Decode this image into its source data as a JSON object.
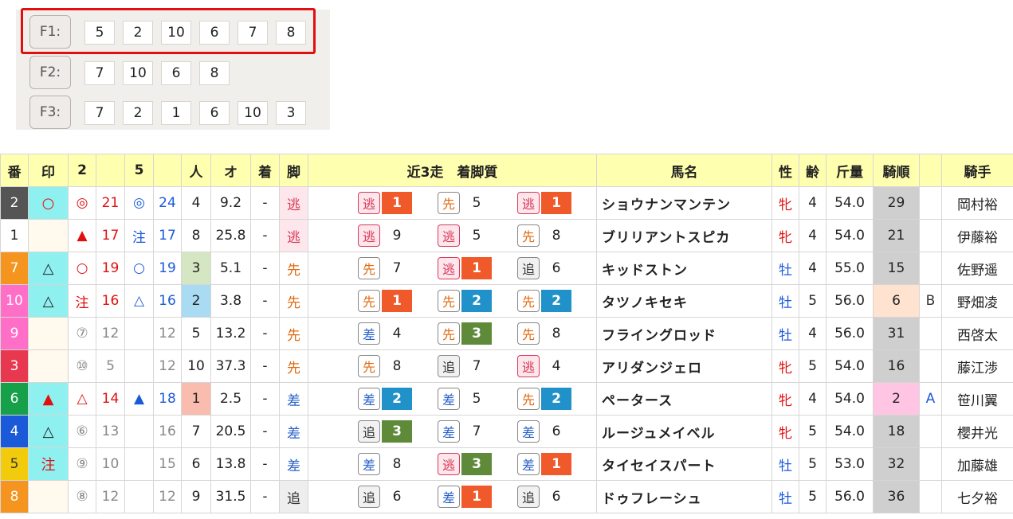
{
  "formations": [
    {
      "label": "F1:",
      "numbers": [
        "5",
        "2",
        "10",
        "6",
        "7",
        "8"
      ]
    },
    {
      "label": "F2:",
      "numbers": [
        "7",
        "10",
        "6",
        "8"
      ]
    },
    {
      "label": "F3:",
      "numbers": [
        "7",
        "2",
        "1",
        "6",
        "10",
        "3"
      ]
    }
  ],
  "table": {
    "headers": {
      "ban": "番",
      "shirushi": "印",
      "col2": "2",
      "col2b": "",
      "col5": "5",
      "col5b": "",
      "ninki": "人",
      "odds": "オ",
      "chaku": "着",
      "ashi": "脚",
      "recent": "近3走　着脚質",
      "name": "馬名",
      "sex": "性",
      "age": "齢",
      "weight": "斤量",
      "order": "騎順",
      "grade": "",
      "jockey": "騎手"
    },
    "rows": [
      {
        "ban": "2",
        "frame_color": "#555555",
        "mark": "○",
        "mark_bg": "#8ff0f0",
        "mark_color": "red",
        "m2": "◎",
        "m2_color": "red",
        "v2": "21",
        "v2_color": "red",
        "m5": "◎",
        "m5_color": "blue",
        "v5": "24",
        "v5_color": "blue",
        "ninki": "4",
        "ninki_bg": "",
        "odds": "9.2",
        "chaku": "-",
        "ashi": "逃",
        "ashi_type": "nige",
        "recent": [
          {
            "style": "逃",
            "type": "nige",
            "rank": "1",
            "rank_class": "r1"
          },
          {
            "style": "先",
            "type": "sen",
            "rank": "5",
            "rank_class": ""
          },
          {
            "style": "逃",
            "type": "nige",
            "rank": "1",
            "rank_class": "r1"
          }
        ],
        "name": "ショウナンマンテン",
        "sex": "牝",
        "sex_type": "f",
        "age": "4",
        "weight": "54.0",
        "order": "29",
        "order_bg": "#cfcfcf",
        "grade": "",
        "grade_type": "",
        "jockey": "岡村裕"
      },
      {
        "ban": "1",
        "frame_color": "#ffffff",
        "mark": "",
        "mark_bg": "#fff9ee",
        "mark_color": "dark",
        "m2": "▲",
        "m2_color": "red",
        "v2": "17",
        "v2_color": "red",
        "m5": "注",
        "m5_color": "blue",
        "v5": "17",
        "v5_color": "blue",
        "ninki": "8",
        "ninki_bg": "",
        "odds": "25.8",
        "chaku": "-",
        "ashi": "逃",
        "ashi_type": "nige",
        "recent": [
          {
            "style": "逃",
            "type": "nige",
            "rank": "9",
            "rank_class": ""
          },
          {
            "style": "逃",
            "type": "nige",
            "rank": "5",
            "rank_class": ""
          },
          {
            "style": "先",
            "type": "sen",
            "rank": "8",
            "rank_class": ""
          }
        ],
        "name": "ブリリアントスピカ",
        "sex": "牝",
        "sex_type": "f",
        "age": "4",
        "weight": "54.0",
        "order": "21",
        "order_bg": "#cfcfcf",
        "grade": "",
        "grade_type": "",
        "jockey": "伊藤裕"
      },
      {
        "ban": "7",
        "frame_color": "#f5951f",
        "mark": "△",
        "mark_bg": "#8ff0f0",
        "mark_color": "dark",
        "m2": "○",
        "m2_color": "red",
        "v2": "19",
        "v2_color": "red",
        "m5": "○",
        "m5_color": "blue",
        "v5": "19",
        "v5_color": "blue",
        "ninki": "3",
        "ninki_bg": "#d5e6c3",
        "odds": "5.1",
        "chaku": "-",
        "ashi": "先",
        "ashi_type": "sen",
        "recent": [
          {
            "style": "先",
            "type": "sen",
            "rank": "7",
            "rank_class": ""
          },
          {
            "style": "逃",
            "type": "nige",
            "rank": "1",
            "rank_class": "r1"
          },
          {
            "style": "追",
            "type": "oi",
            "rank": "6",
            "rank_class": ""
          }
        ],
        "name": "キッドストン",
        "sex": "牡",
        "sex_type": "m",
        "age": "4",
        "weight": "55.0",
        "order": "15",
        "order_bg": "#cfcfcf",
        "grade": "",
        "grade_type": "",
        "jockey": "佐野遥"
      },
      {
        "ban": "10",
        "frame_color": "#ff6fc8",
        "mark": "△",
        "mark_bg": "#8ff0f0",
        "mark_color": "dark",
        "m2": "注",
        "m2_color": "red",
        "v2": "16",
        "v2_color": "red",
        "m5": "△",
        "m5_color": "blue",
        "v5": "16",
        "v5_color": "blue",
        "ninki": "2",
        "ninki_bg": "#a9dbf3",
        "odds": "3.8",
        "chaku": "-",
        "ashi": "先",
        "ashi_type": "sen",
        "recent": [
          {
            "style": "先",
            "type": "sen",
            "rank": "1",
            "rank_class": "r1"
          },
          {
            "style": "先",
            "type": "sen",
            "rank": "2",
            "rank_class": "r2"
          },
          {
            "style": "先",
            "type": "sen",
            "rank": "2",
            "rank_class": "r2"
          }
        ],
        "name": "タツノキセキ",
        "sex": "牡",
        "sex_type": "m",
        "age": "5",
        "weight": "56.0",
        "order": "6",
        "order_bg": "#ffe2cf",
        "grade": "B",
        "grade_type": "B",
        "jockey": "野畑凌"
      },
      {
        "ban": "9",
        "frame_color": "#ff6fc8",
        "mark": "",
        "mark_bg": "#fff9ee",
        "mark_color": "dark",
        "m2": "⑦",
        "m2_color": "gray",
        "v2": "12",
        "v2_color": "gray",
        "m5": "",
        "m5_color": "gray",
        "v5": "12",
        "v5_color": "gray",
        "ninki": "5",
        "ninki_bg": "",
        "odds": "13.2",
        "chaku": "-",
        "ashi": "先",
        "ashi_type": "sen",
        "recent": [
          {
            "style": "差",
            "type": "sashi",
            "rank": "4",
            "rank_class": ""
          },
          {
            "style": "先",
            "type": "sen",
            "rank": "3",
            "rank_class": "r3"
          },
          {
            "style": "先",
            "type": "sen",
            "rank": "8",
            "rank_class": ""
          }
        ],
        "name": "フライングロッド",
        "sex": "牡",
        "sex_type": "m",
        "age": "4",
        "weight": "56.0",
        "order": "31",
        "order_bg": "#cfcfcf",
        "grade": "",
        "grade_type": "",
        "jockey": "西啓太"
      },
      {
        "ban": "3",
        "frame_color": "#e8384f",
        "mark": "",
        "mark_bg": "#fff9ee",
        "mark_color": "dark",
        "m2": "⑩",
        "m2_color": "gray",
        "v2": "5",
        "v2_color": "gray",
        "m5": "",
        "m5_color": "gray",
        "v5": "12",
        "v5_color": "gray",
        "ninki": "10",
        "ninki_bg": "",
        "odds": "37.3",
        "chaku": "-",
        "ashi": "先",
        "ashi_type": "sen",
        "recent": [
          {
            "style": "先",
            "type": "sen",
            "rank": "8",
            "rank_class": ""
          },
          {
            "style": "追",
            "type": "oi",
            "rank": "7",
            "rank_class": ""
          },
          {
            "style": "逃",
            "type": "nige",
            "rank": "4",
            "rank_class": ""
          }
        ],
        "name": "アリダンジェロ",
        "sex": "牝",
        "sex_type": "f",
        "age": "5",
        "weight": "54.0",
        "order": "16",
        "order_bg": "#cfcfcf",
        "grade": "",
        "grade_type": "",
        "jockey": "藤江渉"
      },
      {
        "ban": "6",
        "frame_color": "#16a04a",
        "mark": "▲",
        "mark_bg": "#8ff0f0",
        "mark_color": "red",
        "m2": "△",
        "m2_color": "red",
        "v2": "14",
        "v2_color": "red",
        "m5": "▲",
        "m5_color": "blue",
        "v5": "18",
        "v5_color": "blue",
        "ninki": "1",
        "ninki_bg": "#f9bcae",
        "odds": "2.5",
        "chaku": "-",
        "ashi": "差",
        "ashi_type": "sashi",
        "recent": [
          {
            "style": "差",
            "type": "sashi",
            "rank": "2",
            "rank_class": "r2"
          },
          {
            "style": "差",
            "type": "sashi",
            "rank": "5",
            "rank_class": ""
          },
          {
            "style": "先",
            "type": "sen",
            "rank": "2",
            "rank_class": "r2"
          }
        ],
        "name": "ペータース",
        "sex": "牝",
        "sex_type": "f",
        "age": "4",
        "weight": "54.0",
        "order": "2",
        "order_bg": "#ffc5e3",
        "grade": "A",
        "grade_type": "A",
        "jockey": "笹川翼"
      },
      {
        "ban": "4",
        "frame_color": "#1a5ad8",
        "mark": "△",
        "mark_bg": "#8ff0f0",
        "mark_color": "dark",
        "m2": "⑥",
        "m2_color": "gray",
        "v2": "13",
        "v2_color": "gray",
        "m5": "",
        "m5_color": "gray",
        "v5": "16",
        "v5_color": "gray",
        "ninki": "7",
        "ninki_bg": "",
        "odds": "20.5",
        "chaku": "-",
        "ashi": "差",
        "ashi_type": "sashi",
        "recent": [
          {
            "style": "追",
            "type": "oi",
            "rank": "3",
            "rank_class": "r3"
          },
          {
            "style": "差",
            "type": "sashi",
            "rank": "7",
            "rank_class": ""
          },
          {
            "style": "差",
            "type": "sashi",
            "rank": "6",
            "rank_class": ""
          }
        ],
        "name": "ルージュメイベル",
        "sex": "牝",
        "sex_type": "f",
        "age": "5",
        "weight": "54.0",
        "order": "18",
        "order_bg": "#cfcfcf",
        "grade": "",
        "grade_type": "",
        "jockey": "櫻井光"
      },
      {
        "ban": "5",
        "frame_color": "#f2cc0c",
        "mark": "注",
        "mark_bg": "#8ff0f0",
        "mark_color": "red",
        "m2": "⑨",
        "m2_color": "gray",
        "v2": "10",
        "v2_color": "gray",
        "m5": "",
        "m5_color": "gray",
        "v5": "15",
        "v5_color": "gray",
        "ninki": "6",
        "ninki_bg": "",
        "odds": "13.8",
        "chaku": "-",
        "ashi": "差",
        "ashi_type": "sashi",
        "recent": [
          {
            "style": "差",
            "type": "sashi",
            "rank": "8",
            "rank_class": ""
          },
          {
            "style": "逃",
            "type": "nige",
            "rank": "3",
            "rank_class": "r3"
          },
          {
            "style": "差",
            "type": "sashi",
            "rank": "1",
            "rank_class": "r1"
          }
        ],
        "name": "タイセイスパート",
        "sex": "牡",
        "sex_type": "m",
        "age": "5",
        "weight": "53.0",
        "order": "32",
        "order_bg": "#cfcfcf",
        "grade": "",
        "grade_type": "",
        "jockey": "加藤雄"
      },
      {
        "ban": "8",
        "frame_color": "#f5951f",
        "mark": "",
        "mark_bg": "#fff9ee",
        "mark_color": "dark",
        "m2": "⑧",
        "m2_color": "gray",
        "v2": "12",
        "v2_color": "gray",
        "m5": "",
        "m5_color": "gray",
        "v5": "12",
        "v5_color": "gray",
        "ninki": "9",
        "ninki_bg": "",
        "odds": "31.5",
        "chaku": "-",
        "ashi": "追",
        "ashi_type": "oi",
        "recent": [
          {
            "style": "追",
            "type": "oi",
            "rank": "6",
            "rank_class": ""
          },
          {
            "style": "差",
            "type": "sashi",
            "rank": "1",
            "rank_class": "r1"
          },
          {
            "style": "追",
            "type": "oi",
            "rank": "6",
            "rank_class": ""
          }
        ],
        "name": "ドゥフレーシュ",
        "sex": "牡",
        "sex_type": "m",
        "age": "5",
        "weight": "56.0",
        "order": "36",
        "order_bg": "#cfcfcf",
        "grade": "",
        "grade_type": "",
        "jockey": "七夕裕"
      }
    ]
  }
}
